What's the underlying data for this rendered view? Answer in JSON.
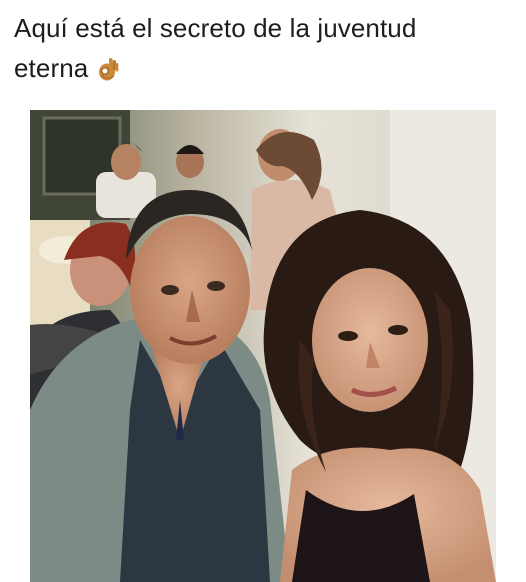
{
  "post": {
    "caption_line1": "Aquí está el secreto de la juventud",
    "caption_line2": "eterna",
    "caption_emoji": "ok-hand-emoji"
  },
  "photo": {
    "subject": "photo-of-older-man-and-young-woman-at-dinner"
  },
  "colors": {
    "background": "#ffffff",
    "caption_text": "#1d1d1d",
    "emoji_skin": "#c98a3c"
  }
}
